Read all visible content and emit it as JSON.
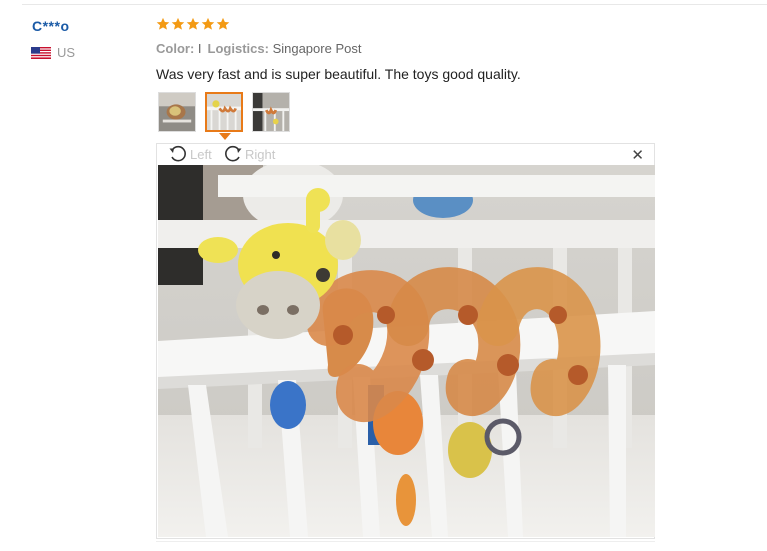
{
  "review": {
    "user": "C***o",
    "country_code": "US",
    "rating": 5,
    "star_color": "#f39a14",
    "meta": {
      "color_label": "Color:",
      "color_value": "I",
      "logistics_label": "Logistics:",
      "logistics_value": "Singapore Post"
    },
    "text": "Was very fast and is super beautiful. The toys good quality.",
    "thumbnails": [
      {
        "name": "photo-thumbnail-1",
        "selected": false
      },
      {
        "name": "photo-thumbnail-2",
        "selected": true
      },
      {
        "name": "photo-thumbnail-3",
        "selected": false
      }
    ]
  },
  "viewer": {
    "rotate_left_label": "Left",
    "rotate_right_label": "Right",
    "close_symbol": "✕",
    "icons": {
      "rotate_left": "rotate-left-icon",
      "rotate_right": "rotate-right-icon",
      "close": "close-icon"
    }
  },
  "colors": {
    "user_name": "#1a5aa6",
    "accent": "#e87a18",
    "muted": "#999999"
  }
}
